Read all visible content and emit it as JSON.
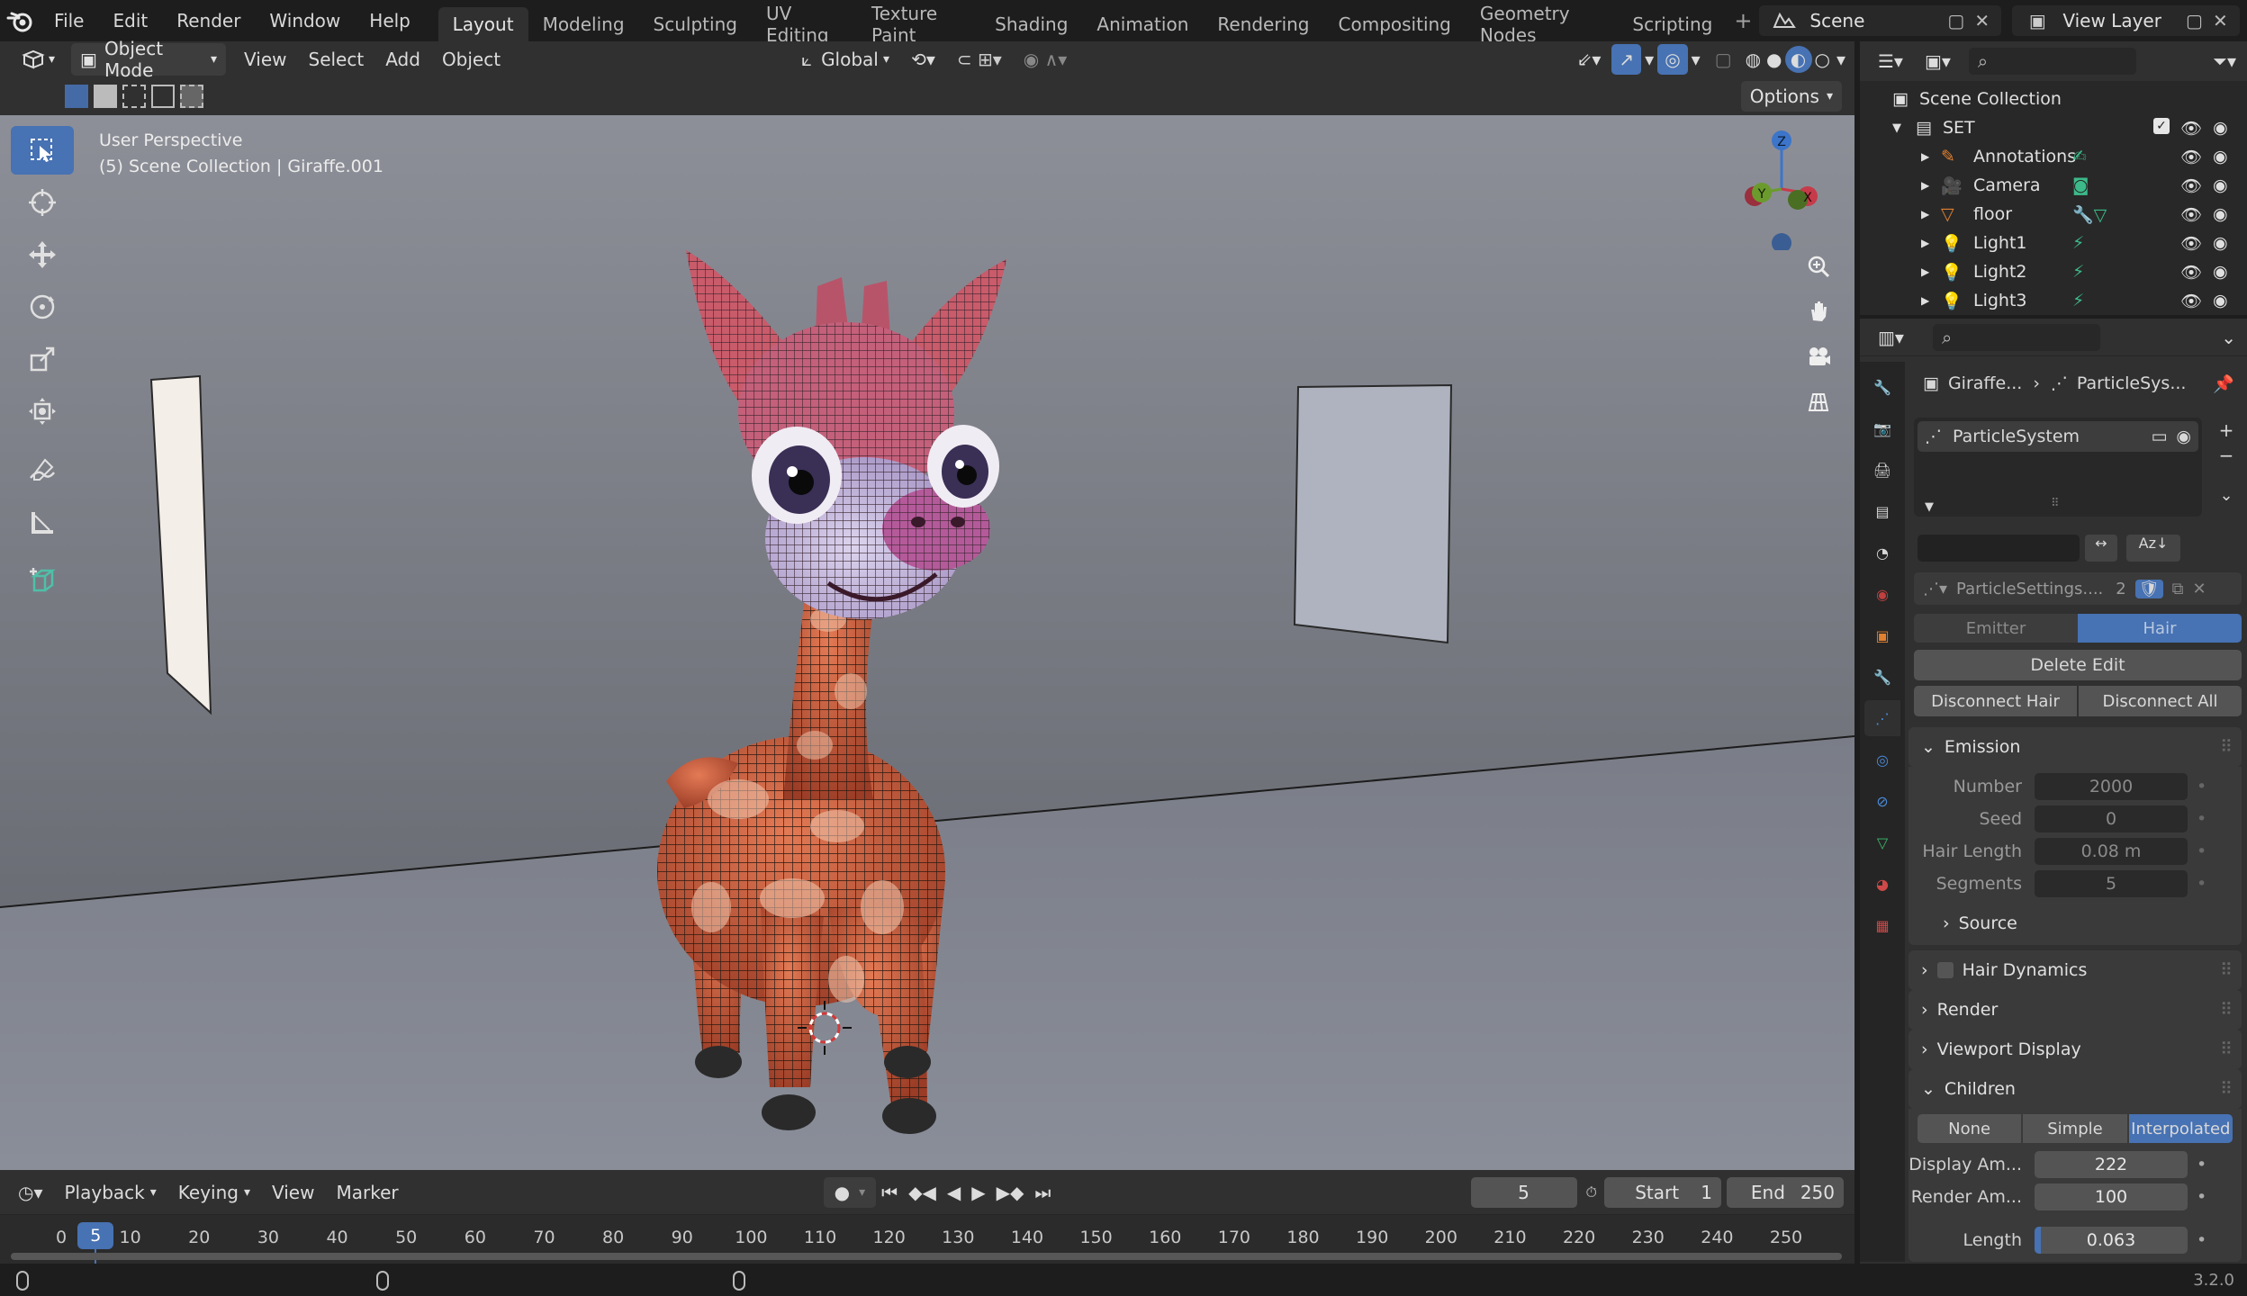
{
  "topbar": {
    "menus": [
      "File",
      "Edit",
      "Render",
      "Window",
      "Help"
    ],
    "workspaces": [
      "Layout",
      "Modeling",
      "Sculpting",
      "UV Editing",
      "Texture Paint",
      "Shading",
      "Animation",
      "Rendering",
      "Compositing",
      "Geometry Nodes",
      "Scripting"
    ],
    "active_workspace": "Layout",
    "scene": "Scene",
    "view_layer": "View Layer"
  },
  "viewport_header": {
    "mode": "Object Mode",
    "menus": [
      "View",
      "Select",
      "Add",
      "Object"
    ],
    "orientation": "Global",
    "options": "Options"
  },
  "viewport": {
    "perspective": "User Perspective",
    "collection_info": "(5) Scene Collection | Giraffe.001",
    "gizmo": {
      "z": "Z",
      "y": "Y",
      "x": "X"
    }
  },
  "outliner": {
    "root": "Scene Collection",
    "collection": "SET",
    "items": [
      {
        "name": "Annotations",
        "icon": "annotation-icon"
      },
      {
        "name": "Camera",
        "icon": "camera-icon"
      },
      {
        "name": "floor",
        "icon": "mesh-icon"
      },
      {
        "name": "Light1",
        "icon": "light-icon"
      },
      {
        "name": "Light2",
        "icon": "light-icon"
      },
      {
        "name": "Light3",
        "icon": "light-icon"
      }
    ]
  },
  "properties": {
    "breadcrumb_object": "Giraffe...",
    "breadcrumb_system": "ParticleSys...",
    "list_item": "ParticleSystem",
    "settings_name": "ParticleSettings....",
    "settings_users": "2",
    "type_tabs": [
      "Emitter",
      "Hair"
    ],
    "active_type": "Hair",
    "delete_edit": "Delete Edit",
    "disconnect_hair": "Disconnect Hair",
    "disconnect_all": "Disconnect All",
    "emission": {
      "title": "Emission",
      "fields": [
        {
          "label": "Number",
          "value": "2000"
        },
        {
          "label": "Seed",
          "value": "0"
        },
        {
          "label": "Hair Length",
          "value": "0.08 m"
        },
        {
          "label": "Segments",
          "value": "5"
        }
      ],
      "source": "Source"
    },
    "panels": [
      "Hair Dynamics",
      "Render",
      "Viewport Display"
    ],
    "children": {
      "title": "Children",
      "modes": [
        "None",
        "Simple",
        "Interpolated"
      ],
      "active_mode": "Interpolated",
      "fields": [
        {
          "label": "Display Am...",
          "value": "222"
        },
        {
          "label": "Render Am...",
          "value": "100"
        }
      ],
      "length_label": "Length",
      "length_value": "0.063"
    }
  },
  "timeline": {
    "menus": [
      "Playback",
      "Keying",
      "View",
      "Marker"
    ],
    "current_frame": "5",
    "start_label": "Start",
    "start": "1",
    "end_label": "End",
    "end": "250",
    "ruler": [
      "0",
      "10",
      "20",
      "30",
      "40",
      "50",
      "60",
      "70",
      "80",
      "90",
      "100",
      "110",
      "120",
      "130",
      "140",
      "150",
      "160",
      "170",
      "180",
      "190",
      "200",
      "210",
      "220",
      "230",
      "240",
      "250"
    ],
    "playhead": "5"
  },
  "status": {
    "version": "3.2.0"
  },
  "colors": {
    "accent": "#4772b3",
    "header": "#303030",
    "bg": "#1d1d1d"
  }
}
